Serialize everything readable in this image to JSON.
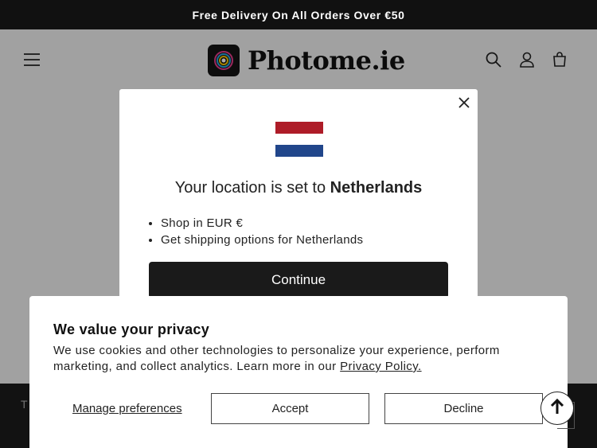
{
  "announcement": "Free Delivery On All Orders Over €50",
  "brand": {
    "name": "Photome.ie"
  },
  "header": {
    "icons": [
      "menu-icon",
      "search-icon",
      "account-icon",
      "cart-icon"
    ]
  },
  "location_modal": {
    "title_prefix": "Your location is set to",
    "country": "Netherlands",
    "items": [
      "Shop in EUR €",
      "Get shipping options for Netherlands"
    ],
    "continue_label": "Continue",
    "flag_colors": [
      "#ae1c28",
      "#ffffff",
      "#21468b"
    ]
  },
  "cookie_banner": {
    "title": "We value your privacy",
    "text": "We use cookies and other technologies to personalize your experience, perform marketing, and collect analytics. Learn more in our",
    "policy_link": "Privacy Policy.",
    "manage_label": "Manage preferences",
    "accept_label": "Accept",
    "decline_label": "Decline"
  },
  "footer": {
    "partial_text": "T"
  },
  "colors": {
    "announcement_bg": "#111111",
    "button_dark": "#1a1a1a"
  }
}
